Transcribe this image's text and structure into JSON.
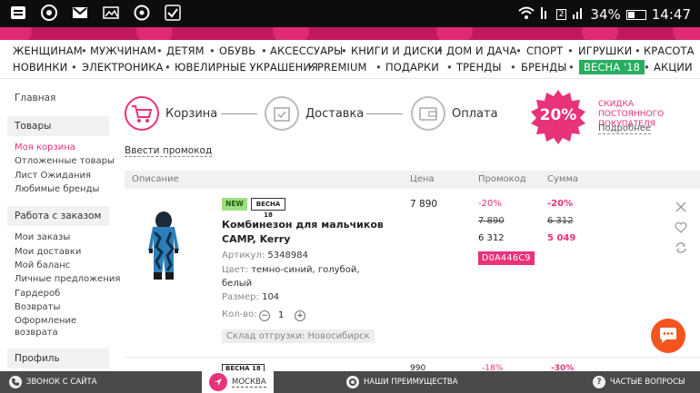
{
  "statusbar": {
    "sim": "2",
    "battery": "34%",
    "time": "14:47"
  },
  "nav": {
    "row1": [
      "ЖЕНЩИНАМ",
      "МУЖЧИНАМ",
      "ДЕТЯМ",
      "ОБУВЬ",
      "АКСЕССУАРЫ",
      "КНИГИ И ДИСКИ",
      "ДОМ И ДАЧА",
      "СПОРТ",
      "ИГРУШКИ",
      "КРАСОТА"
    ],
    "row2": [
      "НОВИНКИ",
      "ЭЛЕКТРОНИКА",
      "ЮВЕЛИРНЫЕ УКРАШЕНИЯ",
      "PREMIUM",
      "ПОДАРКИ",
      "ТРЕНДЫ",
      "БРЕНДЫ",
      "ВЕСНА '18",
      "АКЦИИ"
    ],
    "highlight_color": "#27ae60"
  },
  "sidebar": {
    "home": "Главная",
    "goods_title": "Товары",
    "goods": [
      "Моя корзина",
      "Отложенные товары",
      "Лист Ожидания",
      "Любимые бренды"
    ],
    "orders_title": "Работа с заказом",
    "orders": [
      "Мои заказы",
      "Мои доставки",
      "Мой баланс",
      "Личные предложения",
      "Гардероб",
      "Возвраты",
      "Оформление",
      "возврата"
    ],
    "profile_title": "Профиль"
  },
  "steps": [
    "Корзина",
    "Доставка",
    "Оплата"
  ],
  "discount": {
    "badge": "20%",
    "title_line1": "СКИДКА ПОСТОЯННОГО",
    "title_line2": "ПОКУПАТЕЛЯ",
    "more": "Подробнее"
  },
  "promo_link": "Ввести промокод",
  "table": {
    "headers": [
      "Описание",
      "Цена",
      "Промокод",
      "Сумма"
    ]
  },
  "item": {
    "tag_new": "NEW",
    "tag_season": "ВЕСНА 18",
    "title_line1": "Комбинезон для мальчиков",
    "title_line2": "CAMP, Kerry",
    "article_label": "Артикул:",
    "article": "5348984",
    "color_label": "Цвет:",
    "color_line1": "темно-синий, голубой,",
    "color_line2": "белый",
    "size_label": "Размер:",
    "size": "104",
    "qty_label": "Кол-во:",
    "qty": "1",
    "stock": "Склад отгрузки: Новосибирск",
    "price": "7 890",
    "promo_percent": "-20%",
    "promo_old": "7 890",
    "promo_new": "6 312",
    "sum_percent": "-20%",
    "sum_old": "6 312",
    "sum_new": "5 049",
    "promo_code": "D0A446C9"
  },
  "item2": {
    "tag": "ВЕСНА 18",
    "price": "990",
    "promo": "-18%",
    "sum": "-30%"
  },
  "colors": {
    "accent": "#e8327a",
    "fab": "#f5541e",
    "bottombar": "#4a4a4a"
  },
  "bottombar": {
    "call": "ЗВОНОК С САЙТА",
    "city": "МОСКВА",
    "benefits": "НАШИ ПРЕИМУЩЕСТВА",
    "faq": "ЧАСТЫЕ ВОПРОСЫ"
  }
}
